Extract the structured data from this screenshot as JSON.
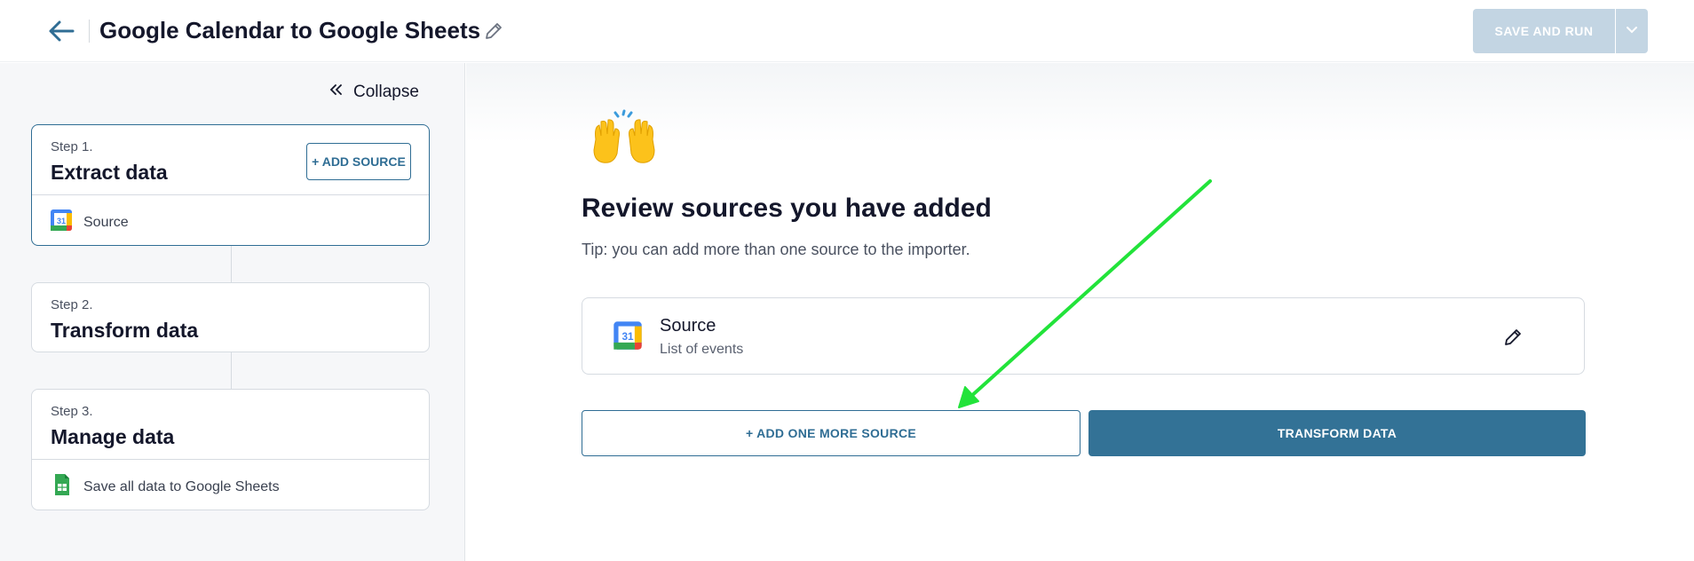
{
  "header": {
    "title": "Google Calendar to Google Sheets",
    "save_run_label": "SAVE AND RUN"
  },
  "sidebar": {
    "collapse_label": "Collapse",
    "steps": [
      {
        "label": "Step 1.",
        "title": "Extract data",
        "action_label": "+ ADD SOURCE",
        "row_label": "Source",
        "row_icon": "google-calendar-icon",
        "active": true
      },
      {
        "label": "Step 2.",
        "title": "Transform data",
        "active": false
      },
      {
        "label": "Step 3.",
        "title": "Manage data",
        "row_label": "Save all data to Google Sheets",
        "row_icon": "google-sheets-icon",
        "active": false
      }
    ]
  },
  "main": {
    "emoji": "raising-hands-icon",
    "title": "Review sources you have added",
    "tip": "Tip: you can add more than one source to the importer.",
    "source": {
      "name": "Source",
      "description": "List of events",
      "icon": "google-calendar-icon"
    },
    "add_more_label": "+ ADD ONE MORE SOURCE",
    "transform_label": "TRANSFORM DATA"
  },
  "annotation": {
    "color": "#22e33a"
  },
  "colors": {
    "primary": "#337296",
    "disabled_button": "#c3d5e3"
  }
}
